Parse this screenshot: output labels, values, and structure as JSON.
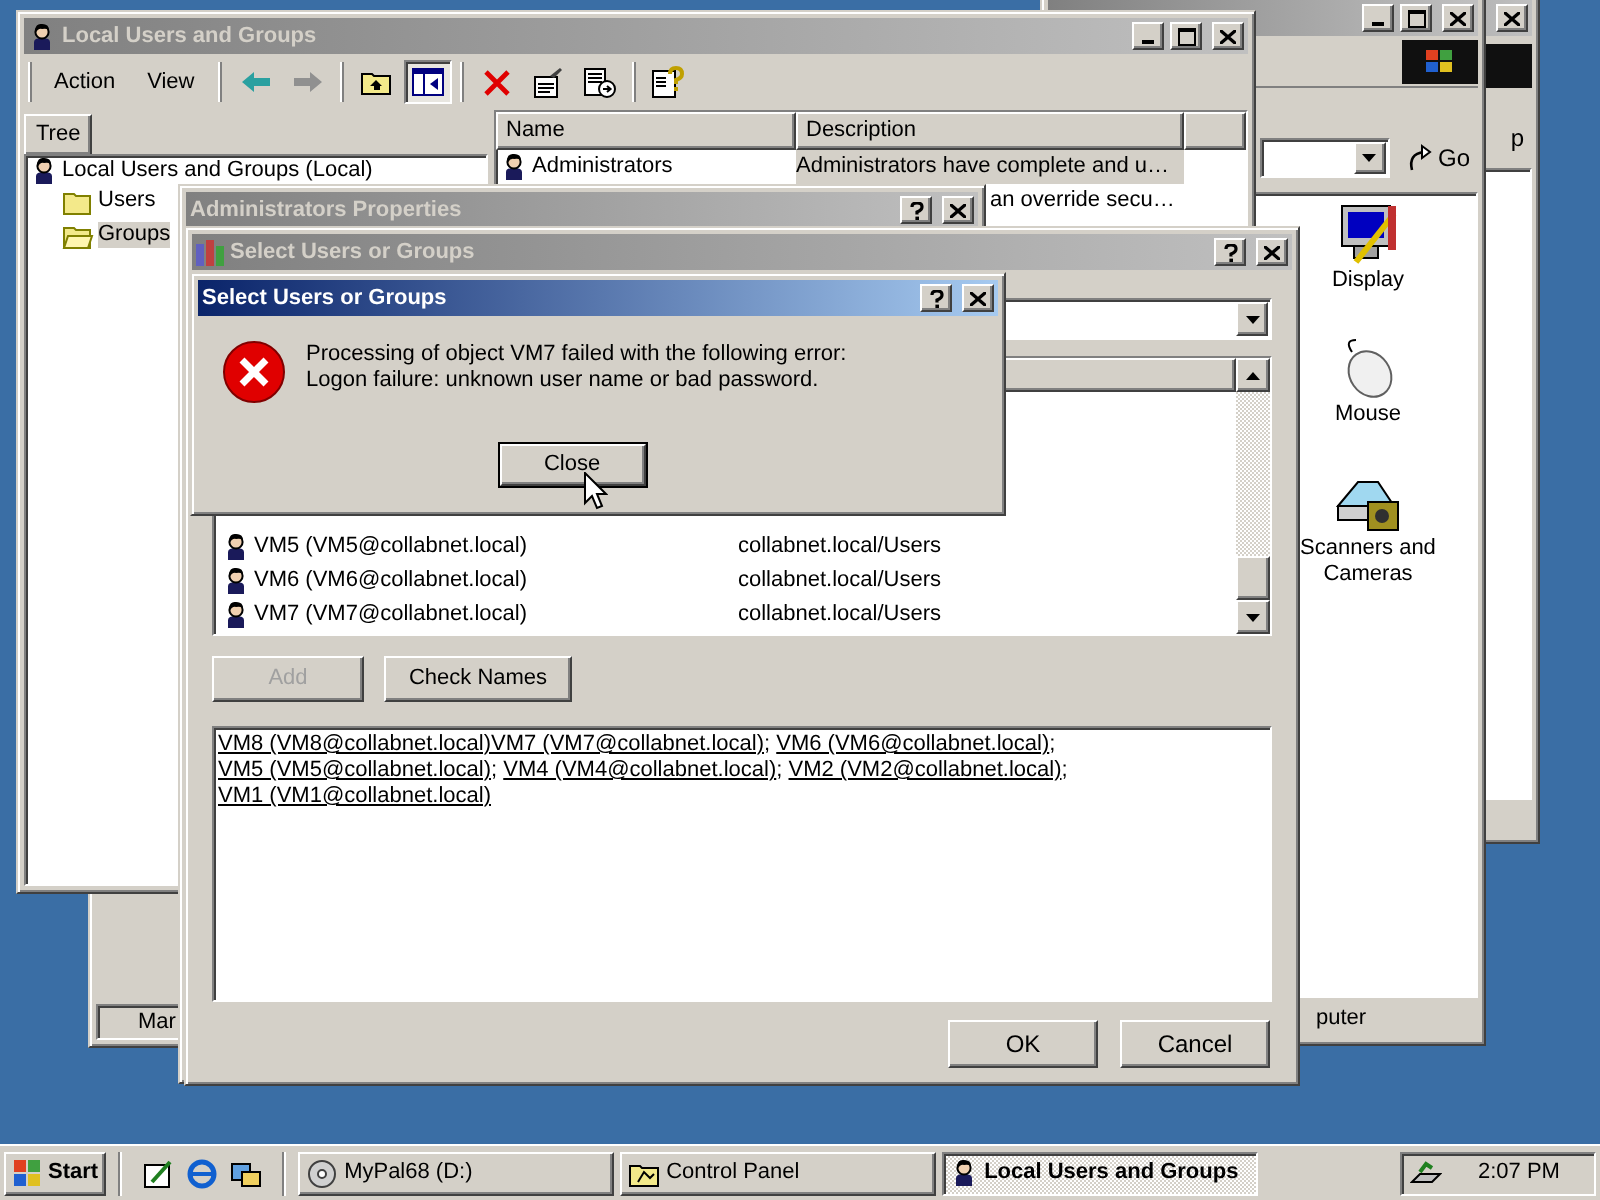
{
  "back_window": {
    "active": false,
    "fragment": "p"
  },
  "control_panel": {
    "active": false,
    "go_button": "Go",
    "icons": [
      {
        "kind": "display",
        "label": "Display"
      },
      {
        "kind": "mouse",
        "label": "Mouse"
      },
      {
        "kind": "scanner",
        "label": "Scanners and Cameras"
      }
    ],
    "status": "puter"
  },
  "side_window": {
    "status": "Mar"
  },
  "local_users_window": {
    "title": "Local Users and Groups",
    "active": false,
    "menu": [
      "Action",
      "View"
    ],
    "tree_tab": "Tree",
    "tree": [
      {
        "label": "Local Users and Groups (Local)",
        "children": [
          {
            "label": "Users",
            "selected": false
          },
          {
            "label": "Groups",
            "selected": true
          }
        ]
      }
    ],
    "columns": [
      "Name",
      "Description"
    ],
    "rows": [
      {
        "name": "Administrators",
        "description": "Administrators have complete and u…",
        "selected": true
      },
      {
        "description": "an override secu…",
        "selected": false
      }
    ]
  },
  "properties_window": {
    "title": "Administrators Properties",
    "active": false
  },
  "select_window": {
    "title": "Select Users or Groups",
    "active": false,
    "rows": [
      {
        "name": "VM5 (VM5@collabnet.local)",
        "folder": "collabnet.local/Users"
      },
      {
        "name": "VM6 (VM6@collabnet.local)",
        "folder": "collabnet.local/Users"
      },
      {
        "name": "VM7 (VM7@collabnet.local)",
        "folder": "collabnet.local/Users"
      }
    ],
    "add_button": {
      "label": "Add",
      "disabled": true
    },
    "check_button": "Check Names",
    "selected_names": [
      {
        "name": "VM8 (VM8@collabnet.local)"
      },
      {
        "name": "VM7 (VM7@collabnet.local)",
        "separator": ";"
      },
      {
        "name": "VM6 (VM6@collabnet.local)",
        "separator": ";"
      },
      {
        "name": "VM5 (VM5@collabnet.local)",
        "separator": ";"
      },
      {
        "name": "VM4 (VM4@collabnet.local)",
        "separator": ";"
      },
      {
        "name": "VM2 (VM2@collabnet.local)",
        "separator": ";"
      },
      {
        "name": "VM1 (VM1@collabnet.local)"
      }
    ],
    "ok_button": "OK",
    "cancel_button": "Cancel"
  },
  "error_dialog": {
    "title": "Select Users or Groups",
    "active": true,
    "message": [
      "Processing of object VM7 failed with the following error:",
      "Logon failure: unknown user name or bad password."
    ],
    "button": "Close"
  },
  "taskbar": {
    "start": "Start",
    "tasks": [
      {
        "label": "MyPal68 (D:)",
        "kind": "drive",
        "selected": false
      },
      {
        "label": "Control Panel",
        "kind": "folder",
        "selected": false
      },
      {
        "label": "Local Users and Groups",
        "kind": "users",
        "selected": true
      }
    ],
    "clock": "2:07 PM"
  }
}
